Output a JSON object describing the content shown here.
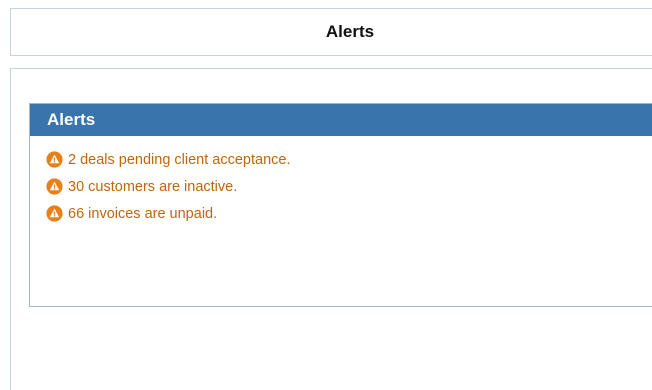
{
  "header": {
    "title": "Alerts"
  },
  "alerts_panel": {
    "title": "Alerts",
    "items": [
      {
        "icon": "warning-icon",
        "text": "2 deals pending client acceptance."
      },
      {
        "icon": "warning-icon",
        "text": "30 customers are inactive."
      },
      {
        "icon": "warning-icon",
        "text": "66 invoices are unpaid."
      }
    ]
  },
  "colors": {
    "header_bg": "#3a74ad",
    "alert_text": "#c0660a",
    "warning_icon": "#e8801a"
  }
}
